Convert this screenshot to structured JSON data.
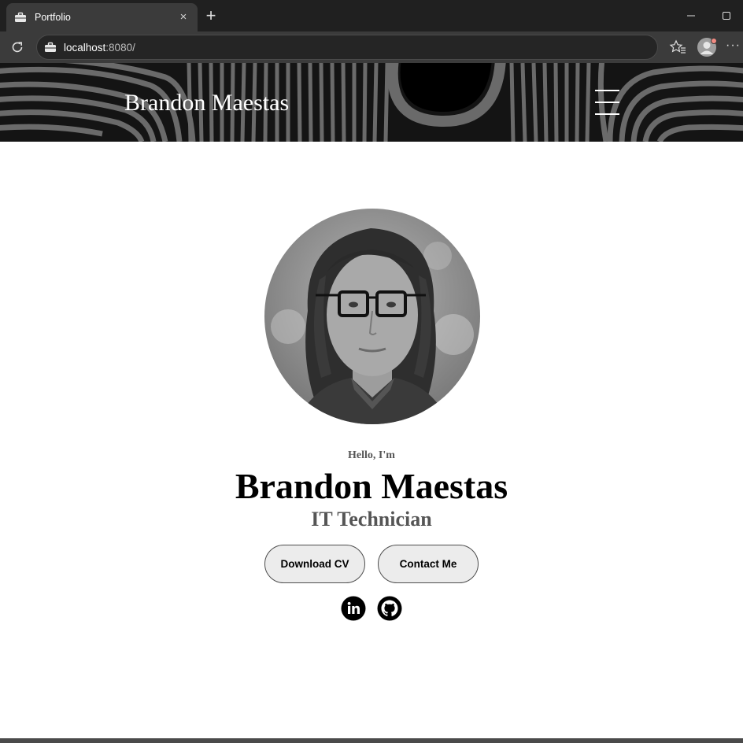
{
  "browser": {
    "tab_title": "Portfolio",
    "tab_close": "×",
    "new_tab": "+",
    "url_host": "localhost",
    "url_rest": ":8080/",
    "more": "···"
  },
  "header": {
    "site_name": "Brandon Maestas"
  },
  "hero": {
    "greeting": "Hello, I'm",
    "name": "Brandon Maestas",
    "role": "IT Technician",
    "buttons": {
      "download_cv": "Download CV",
      "contact_me": "Contact Me"
    },
    "social": [
      "linkedin-icon",
      "github-icon"
    ]
  },
  "colors": {
    "chrome_dark": "#202020",
    "chrome_mid": "#3b3b3b",
    "header_bg": "#1a1a1a",
    "button_bg": "#ececec",
    "subtitle_gray": "#555555"
  }
}
